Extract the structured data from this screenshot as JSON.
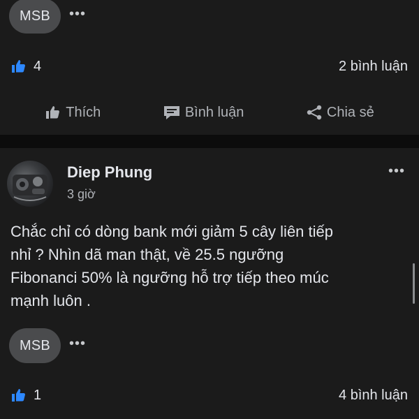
{
  "top_post": {
    "tag": "MSB",
    "more_icon": "more-horizontal-icon",
    "like_count": "4",
    "comment_count": "2 bình luận",
    "actions": {
      "like": "Thích",
      "comment": "Bình luận",
      "share": "Chia sẻ"
    }
  },
  "bottom_post": {
    "author": "Diep Phung",
    "time": "3 giờ",
    "more_icon": "more-horizontal-icon",
    "text_lines": [
      "Chắc chỉ có dòng bank mới giảm 5 cây liên tiếp",
      "nhỉ ? Nhìn dã man thật, về 25.5 ngưỡng",
      "Fibonanci 50% là ngưỡng hỗ trợ tiếp theo múc",
      "mạnh luôn ."
    ],
    "tag": "MSB",
    "like_count": "1",
    "comment_count": "4 bình luận"
  },
  "colors": {
    "background": "#1b1b1b",
    "separator": "#0c0c0c",
    "pill": "#4a4b4d",
    "text": "#e4e6eb",
    "muted": "#b0b3b8",
    "like_blue": "#2d88ff"
  },
  "icons": {
    "like_reaction": "thumbs-up-icon",
    "like_action": "thumbs-up-outline-icon",
    "comment_action": "comment-icon",
    "share_action": "share-icon"
  }
}
